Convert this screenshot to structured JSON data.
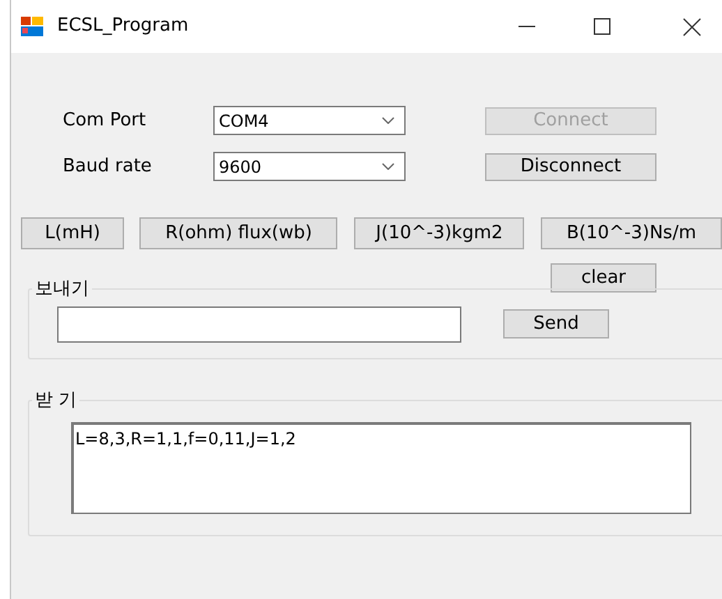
{
  "window": {
    "title": "ECSL_Program"
  },
  "connection": [
    {
      "label": "Com Port",
      "value": "COM4",
      "button": {
        "label": "Connect",
        "disabled": true
      }
    },
    {
      "label": "Baud rate",
      "value": "9600",
      "button": {
        "label": "Disconnect",
        "disabled": false
      }
    }
  ],
  "unit_buttons": [
    "L(mH)",
    "R(ohm) flux(wb)",
    "J(10^-3)kgm2",
    "B(10^-3)Ns/m"
  ],
  "clear_button": "clear",
  "send_group": {
    "title": "보내기",
    "button": "Send"
  },
  "receive_group": {
    "title": "받 기",
    "text": "L=8,3,R=1,1,f=0,11,J=1,2"
  }
}
